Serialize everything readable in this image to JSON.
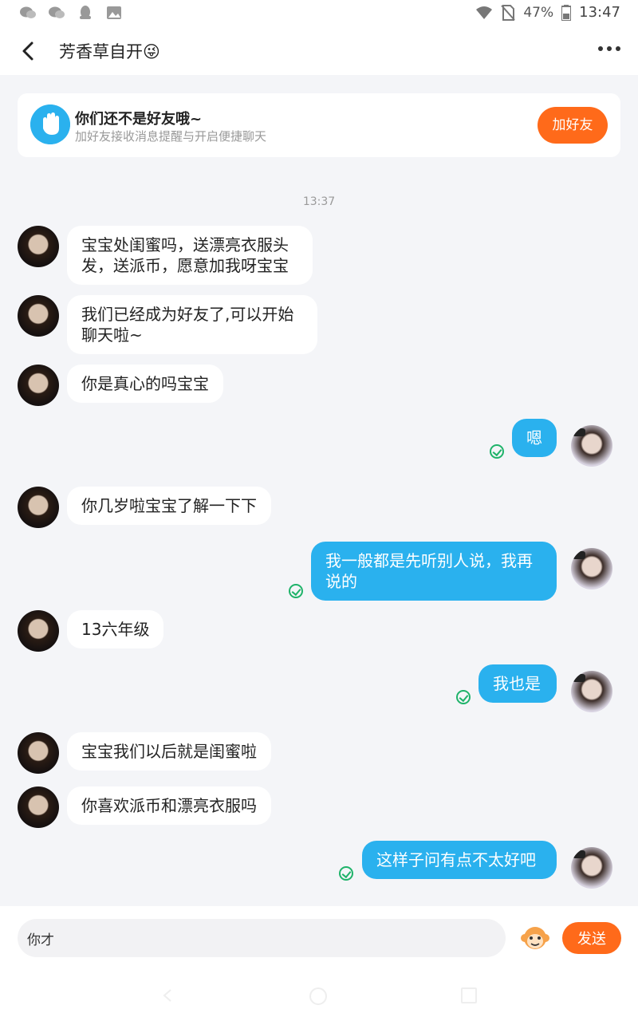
{
  "status_bar": {
    "battery": "47%",
    "time": "13:47"
  },
  "header": {
    "title": "芳香草自开😜"
  },
  "friend_card": {
    "title": "你们还不是好友哦~",
    "subtitle": "加好友接收消息提醒与开启便捷聊天",
    "button": "加好友"
  },
  "timestamp": "13:37",
  "messages": [
    {
      "text_line1": "宝宝处闺蜜吗，送漂亮衣服头",
      "text_line2": "发，送派币，愿意加我呀宝宝"
    },
    {
      "text_line1": "我们已经成为好友了,可以开始",
      "text_line2": "聊天啦~"
    },
    {
      "text": "你是真心的吗宝宝"
    },
    {
      "text": "嗯"
    },
    {
      "text": "你几岁啦宝宝了解一下下"
    },
    {
      "text_line1": "我一般都是先听别人说，我再",
      "text_line2": "说的"
    },
    {
      "text": "13六年级"
    },
    {
      "text": "我也是"
    },
    {
      "text": "宝宝我们以后就是闺蜜啦"
    },
    {
      "text": "你喜欢派币和漂亮衣服吗"
    },
    {
      "text": "这样子问有点不太好吧"
    }
  ],
  "input": {
    "value": "你才",
    "send": "发送"
  }
}
